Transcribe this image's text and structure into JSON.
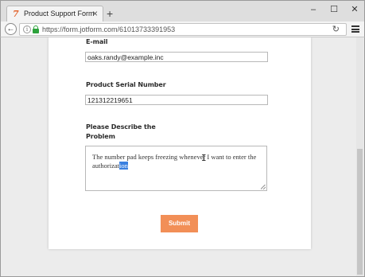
{
  "browser": {
    "tab_title": "Product Support Form",
    "tab_favicon": "7",
    "tab_close": "×",
    "new_tab": "+",
    "url": "https://form.jotform.com/61013733391953",
    "window_controls": {
      "minimize": "–",
      "maximize": "☐",
      "close": "✕"
    },
    "back": "←",
    "info": "i",
    "reload": "↻"
  },
  "form": {
    "email_label": "E-mail",
    "email_value": "oaks.randy@example.inc",
    "serial_label": "Product Serial Number",
    "serial_value": "121312219651",
    "problem_label_line1": "Please Describe the",
    "problem_label_line2": "Problem",
    "problem_text_before": "The number pad keeps freezing whenever I want to enter the authorizat",
    "problem_text_selected": "ion",
    "submit_label": "Submit"
  },
  "colors": {
    "submit": "#f28f57",
    "selection": "#3a80e0",
    "favicon": "#e2622b",
    "lock": "#2da23c"
  }
}
